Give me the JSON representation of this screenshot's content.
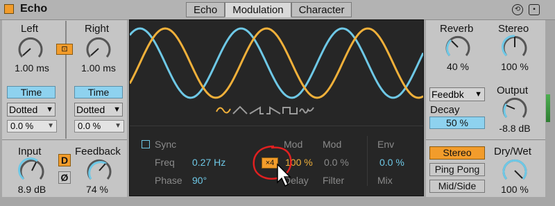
{
  "header": {
    "title": "Echo",
    "tabs": [
      {
        "label": "Echo"
      },
      {
        "label": "Modulation"
      },
      {
        "label": "Character"
      }
    ],
    "active_tab": "Modulation"
  },
  "left": {
    "left_label": "Left",
    "left_value": "1.00 ms",
    "right_label": "Right",
    "right_value": "1.00 ms",
    "link_icon": "link-icon",
    "time_left_label": "Time",
    "time_right_label": "Time",
    "mode_left": "Dotted",
    "mode_right": "Dotted",
    "offset_left": "0.0 %",
    "offset_right": "0.0 %",
    "input_label": "Input",
    "input_value": "8.9 dB",
    "feedback_label": "Feedback",
    "feedback_value": "74 %",
    "d_button": "D",
    "phase_button": "Ø"
  },
  "display": {
    "waveform_icons": [
      "sine-icon",
      "triangle-icon",
      "saw-icon",
      "ramp-icon",
      "square-icon",
      "random-icon"
    ],
    "sync_label": "Sync",
    "freq_label": "Freq",
    "freq_value": "0.27 Hz",
    "phase_label": "Phase",
    "phase_value": "90°",
    "mod_label_1": "Mod",
    "mod_label_2": "Mod",
    "x4_label": "×4",
    "mod_delay_value": "100 %",
    "mod_filter_value": "0.0 %",
    "delay_label": "Delay",
    "filter_label": "Filter",
    "env_label": "Env",
    "env_value": "0.0 %",
    "mix_label": "Mix"
  },
  "right": {
    "reverb_label": "Reverb",
    "reverb_value": "40 %",
    "stereo_label": "Stereo",
    "stereo_value": "100 %",
    "reverb_pos": "Feedbk",
    "output_label": "Output",
    "output_value": "-8.8 dB",
    "decay_label": "Decay",
    "decay_value": "50 %",
    "mode_stereo": "Stereo",
    "mode_pingpong": "Ping Pong",
    "mode_midside": "Mid/Side",
    "drywet_label": "Dry/Wet",
    "drywet_value": "100 %"
  },
  "colors": {
    "accent": "#f29c2b",
    "lfo_orange": "#f0b03a",
    "lfo_blue": "#6ec8e6",
    "value_blue": "#8ed2ef",
    "annotation": "#e02020"
  }
}
